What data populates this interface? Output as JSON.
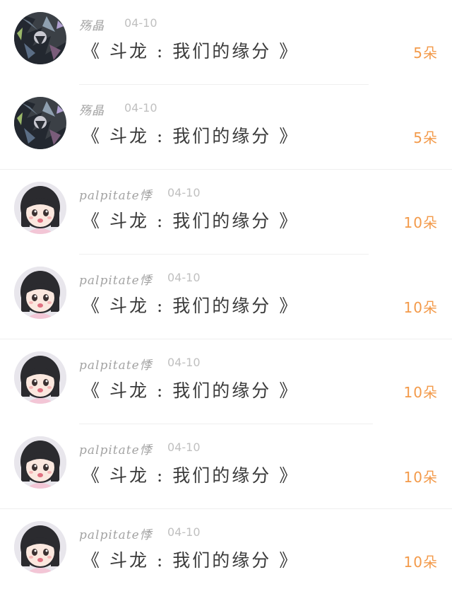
{
  "items": [
    {
      "user": "殇晶",
      "date": "04-10",
      "gift": "《 斗龙 : 我们的缘分 》",
      "count": "5朵",
      "avatar": "dark-anime-avatar"
    },
    {
      "user": "殇晶",
      "date": "04-10",
      "gift": "《 斗龙 : 我们的缘分 》",
      "count": "5朵",
      "avatar": "dark-anime-avatar"
    },
    {
      "user": "palpitate悸",
      "date": "04-10",
      "gift": "《 斗龙 : 我们的缘分 》",
      "count": "10朵",
      "avatar": "anime-girl-avatar"
    },
    {
      "user": "palpitate悸",
      "date": "04-10",
      "gift": "《 斗龙 : 我们的缘分 》",
      "count": "10朵",
      "avatar": "anime-girl-avatar"
    },
    {
      "user": "palpitate悸",
      "date": "04-10",
      "gift": "《 斗龙 : 我们的缘分 》",
      "count": "10朵",
      "avatar": "anime-girl-avatar"
    },
    {
      "user": "palpitate悸",
      "date": "04-10",
      "gift": "《 斗龙 : 我们的缘分 》",
      "count": "10朵",
      "avatar": "anime-girl-avatar"
    },
    {
      "user": "palpitate悸",
      "date": "04-10",
      "gift": "《 斗龙 : 我们的缘分 》",
      "count": "10朵",
      "avatar": "anime-girl-avatar"
    }
  ],
  "colors": {
    "count": "#f39a4a",
    "username": "#a3a3a3",
    "date": "#c0c0c0",
    "gift_title": "#3a3a3a",
    "divider": "#efefef"
  }
}
